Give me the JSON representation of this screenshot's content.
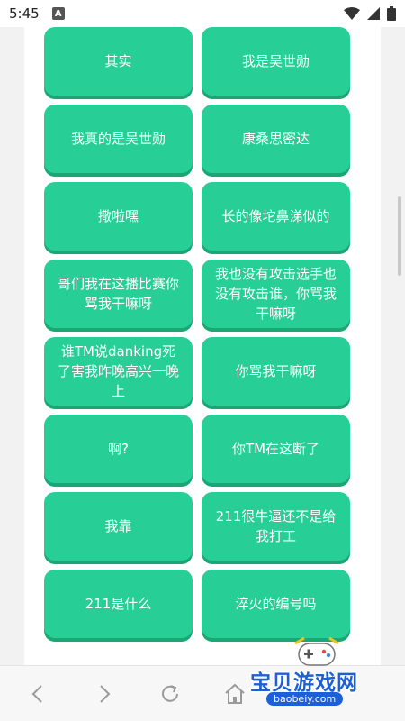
{
  "status_bar": {
    "time": "5:45",
    "notif_badge": "A"
  },
  "buttons": [
    {
      "label": "其实"
    },
    {
      "label": "我是吴世勋"
    },
    {
      "label": "我真的是吴世勋"
    },
    {
      "label": "康桑思密达"
    },
    {
      "label": "撒啦嘿"
    },
    {
      "label": "长的像坨鼻涕似的"
    },
    {
      "label": "哥们我在这播比赛你骂我干嘛呀"
    },
    {
      "label": "我也没有攻击选手也没有攻击谁，你骂我干嘛呀"
    },
    {
      "label": "谁TM说danking死了害我昨晚高兴一晚上"
    },
    {
      "label": "你骂我干嘛呀"
    },
    {
      "label": "啊?"
    },
    {
      "label": "你TM在这断了"
    },
    {
      "label": "我靠"
    },
    {
      "label": "211很牛逼还不是给我打工"
    },
    {
      "label": "211是什么"
    },
    {
      "label": "淬火的编号吗"
    }
  ],
  "nav": {
    "icons": [
      "back-icon",
      "forward-icon",
      "refresh-icon",
      "home-icon"
    ]
  },
  "watermark": {
    "title": "宝贝游戏网",
    "url": "baobeiy.com"
  },
  "colors": {
    "button": "#27ce95",
    "button_shadow": "#1aa675",
    "watermark": "#1d5fd6"
  }
}
